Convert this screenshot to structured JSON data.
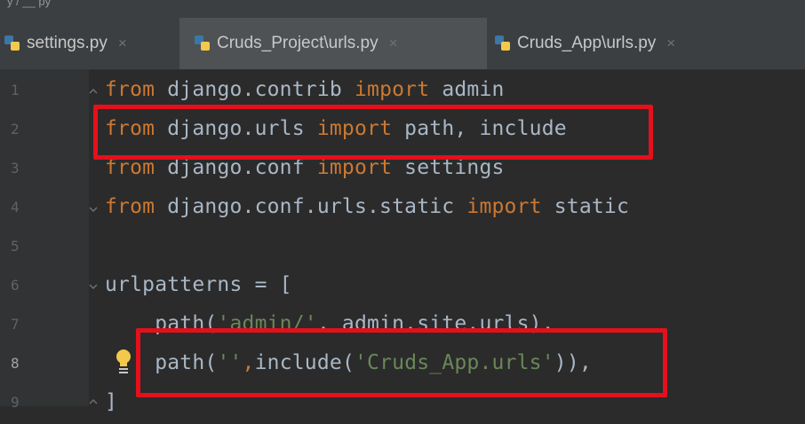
{
  "breadcrumb": "y  /  __  py",
  "tabs": [
    {
      "label": "settings.py",
      "close": "×",
      "active": false
    },
    {
      "label": "Cruds_Project\\urls.py",
      "close": "×",
      "active": true
    },
    {
      "label": "Cruds_App\\urls.py",
      "close": "×",
      "active": false
    }
  ],
  "lines": [
    {
      "num": "1",
      "parts": [
        {
          "t": "from",
          "c": "kw"
        },
        {
          "t": " django.contrib ",
          "c": ""
        },
        {
          "t": "import",
          "c": "kw"
        },
        {
          "t": " admin",
          "c": ""
        }
      ]
    },
    {
      "num": "2",
      "parts": [
        {
          "t": "from",
          "c": "kw"
        },
        {
          "t": " django.urls ",
          "c": ""
        },
        {
          "t": "import",
          "c": "kw"
        },
        {
          "t": " path, include",
          "c": ""
        }
      ]
    },
    {
      "num": "3",
      "parts": [
        {
          "t": "from",
          "c": "kw"
        },
        {
          "t": " django.conf ",
          "c": ""
        },
        {
          "t": "import",
          "c": "kw"
        },
        {
          "t": " settings",
          "c": ""
        }
      ]
    },
    {
      "num": "4",
      "parts": [
        {
          "t": "from",
          "c": "kw"
        },
        {
          "t": " django.conf.urls.static ",
          "c": ""
        },
        {
          "t": "import",
          "c": "kw"
        },
        {
          "t": " static",
          "c": ""
        }
      ]
    },
    {
      "num": "5",
      "parts": []
    },
    {
      "num": "6",
      "parts": [
        {
          "t": "urlpatterns = [",
          "c": ""
        }
      ]
    },
    {
      "num": "7",
      "parts": [
        {
          "t": "    path(",
          "c": ""
        },
        {
          "t": "'admin/'",
          "c": "str"
        },
        {
          "t": ", admin.site.urls),",
          "c": ""
        }
      ]
    },
    {
      "num": "8",
      "parts": [
        {
          "t": "    path(",
          "c": ""
        },
        {
          "t": "''",
          "c": "str"
        },
        {
          "t": ",",
          "c": "kw"
        },
        {
          "t": "include(",
          "c": ""
        },
        {
          "t": "'Cruds_App.urls'",
          "c": "str"
        },
        {
          "t": ")),",
          "c": ""
        }
      ]
    },
    {
      "num": "9",
      "parts": [
        {
          "t": "]",
          "c": ""
        }
      ]
    }
  ],
  "colors": {
    "keyword": "#cc7832",
    "string": "#6a8759",
    "text": "#a9b7c6",
    "highlight": "#e4101b"
  },
  "icons": {
    "python": "python-file-icon",
    "bulb": "intention-bulb-icon"
  }
}
